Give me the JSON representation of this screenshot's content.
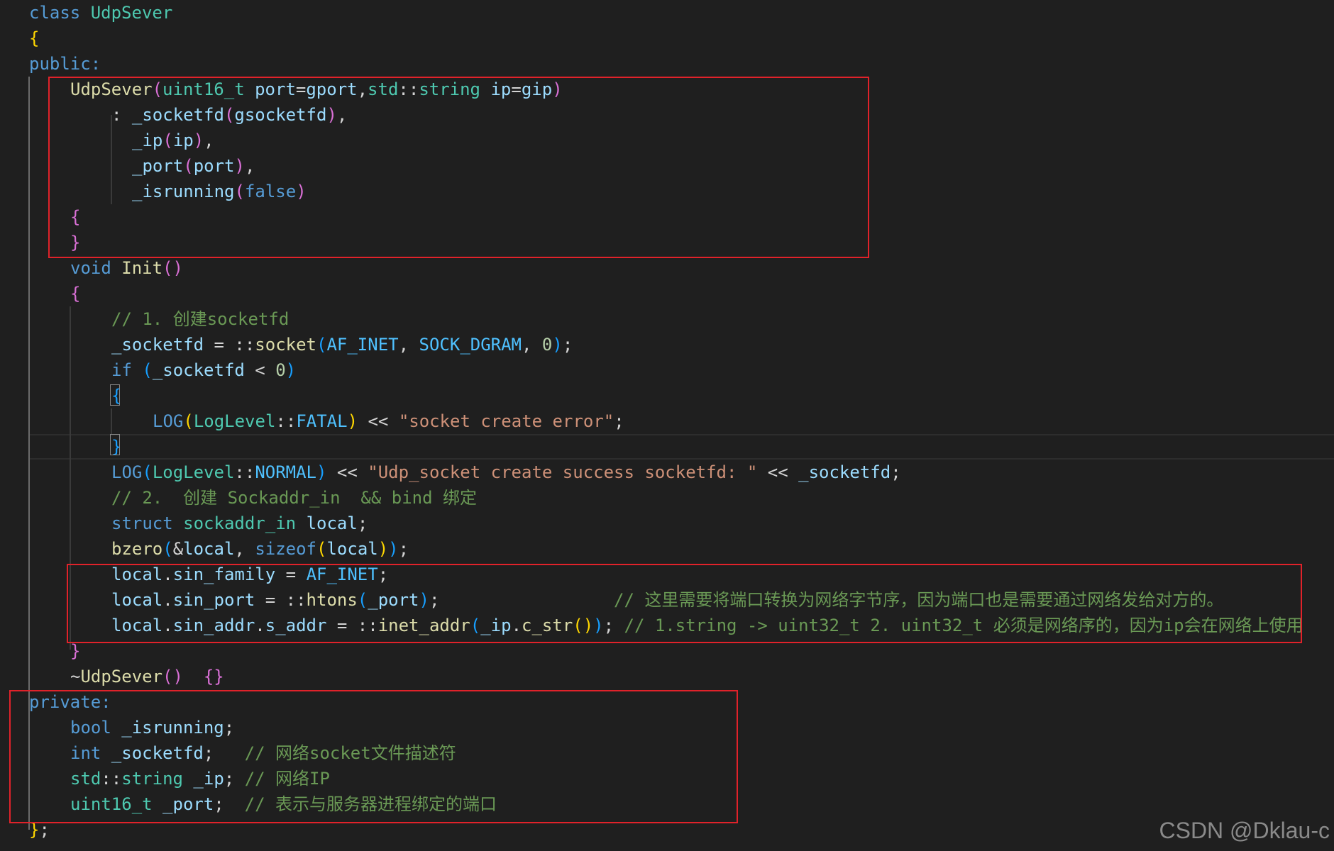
{
  "colors": {
    "background": "#1f1f1f",
    "keyword": "#569cd6",
    "type": "#4ec9b0",
    "function": "#dcdcaa",
    "variable": "#9cdcfe",
    "string": "#ce9178",
    "number": "#b5cea8",
    "comment": "#6a9955",
    "enum_constant": "#4fc1ff",
    "default": "#d4d4d4",
    "bracket_level_1": "#ffd700",
    "bracket_level_2": "#da70d6",
    "bracket_level_3": "#179fff",
    "highlight_box": "#e0222a"
  },
  "code_lines": [
    {
      "indent": 1,
      "tokens": [
        [
          "class ",
          "kw"
        ],
        [
          "UdpSever",
          "ty"
        ]
      ]
    },
    {
      "indent": 1,
      "tokens": [
        [
          "{",
          "b1"
        ]
      ]
    },
    {
      "indent": 1,
      "tokens": [
        [
          "public:",
          "kw"
        ]
      ]
    },
    {
      "indent": 3,
      "tokens": [
        [
          "UdpSever",
          "fn"
        ],
        [
          "(",
          "b2"
        ],
        [
          "uint16_t",
          "ty"
        ],
        [
          " ",
          "pun"
        ],
        [
          "port",
          "var"
        ],
        [
          "=",
          "pun"
        ],
        [
          "gport",
          "var"
        ],
        [
          ",",
          "pun"
        ],
        [
          "std",
          "ty"
        ],
        [
          "::",
          "pun"
        ],
        [
          "string",
          "ty"
        ],
        [
          " ",
          "pun"
        ],
        [
          "ip",
          "var"
        ],
        [
          "=",
          "pun"
        ],
        [
          "gip",
          "var"
        ],
        [
          ")",
          "b2"
        ]
      ]
    },
    {
      "indent": 5,
      "tokens": [
        [
          ": ",
          "pun"
        ],
        [
          "_socketfd",
          "var"
        ],
        [
          "(",
          "b2"
        ],
        [
          "gsocketfd",
          "var"
        ],
        [
          ")",
          "b2"
        ],
        [
          ",",
          "pun"
        ]
      ]
    },
    {
      "indent": 6,
      "tokens": [
        [
          "_ip",
          "var"
        ],
        [
          "(",
          "b2"
        ],
        [
          "ip",
          "var"
        ],
        [
          ")",
          "b2"
        ],
        [
          ",",
          "pun"
        ]
      ]
    },
    {
      "indent": 6,
      "tokens": [
        [
          "_port",
          "var"
        ],
        [
          "(",
          "b2"
        ],
        [
          "port",
          "var"
        ],
        [
          ")",
          "b2"
        ],
        [
          ",",
          "pun"
        ]
      ]
    },
    {
      "indent": 6,
      "tokens": [
        [
          "_isrunning",
          "var"
        ],
        [
          "(",
          "b2"
        ],
        [
          "false",
          "kw"
        ],
        [
          ")",
          "b2"
        ]
      ]
    },
    {
      "indent": 3,
      "tokens": [
        [
          "{",
          "b2"
        ]
      ]
    },
    {
      "indent": 3,
      "tokens": [
        [
          "}",
          "b2"
        ]
      ]
    },
    {
      "indent": 3,
      "tokens": [
        [
          "void ",
          "kw"
        ],
        [
          "Init",
          "fn"
        ],
        [
          "()",
          "b2"
        ]
      ]
    },
    {
      "indent": 3,
      "tokens": [
        [
          "{",
          "b2"
        ]
      ]
    },
    {
      "indent": 5,
      "tokens": [
        [
          "// 1. 创建socketfd",
          "cm"
        ]
      ]
    },
    {
      "indent": 5,
      "tokens": [
        [
          "_socketfd",
          "var"
        ],
        [
          " = ::",
          "pun"
        ],
        [
          "socket",
          "fn"
        ],
        [
          "(",
          "b3"
        ],
        [
          "AF_INET",
          "en"
        ],
        [
          ", ",
          "pun"
        ],
        [
          "SOCK_DGRAM",
          "en"
        ],
        [
          ", ",
          "pun"
        ],
        [
          "0",
          "num"
        ],
        [
          ")",
          "b3"
        ],
        [
          ";",
          "pun"
        ]
      ]
    },
    {
      "indent": 5,
      "tokens": [
        [
          "if ",
          "kw"
        ],
        [
          "(",
          "b3"
        ],
        [
          "_socketfd",
          "var"
        ],
        [
          " < ",
          "pun"
        ],
        [
          "0",
          "num"
        ],
        [
          ")",
          "b3"
        ]
      ]
    },
    {
      "indent": 5,
      "tokens": [
        [
          "{",
          "b3"
        ]
      ]
    },
    {
      "indent": 7,
      "tokens": [
        [
          "LOG",
          "kw"
        ],
        [
          "(",
          "b1"
        ],
        [
          "LogLevel",
          "ty"
        ],
        [
          "::",
          "pun"
        ],
        [
          "FATAL",
          "en"
        ],
        [
          ")",
          "b1"
        ],
        [
          " << ",
          "pun"
        ],
        [
          "\"socket create error\"",
          "str"
        ],
        [
          ";",
          "pun"
        ]
      ]
    },
    {
      "indent": 5,
      "tokens": [
        [
          "}",
          "b3"
        ]
      ]
    },
    {
      "indent": 5,
      "tokens": [
        [
          "LOG",
          "kw"
        ],
        [
          "(",
          "b3"
        ],
        [
          "LogLevel",
          "ty"
        ],
        [
          "::",
          "pun"
        ],
        [
          "NORMAL",
          "en"
        ],
        [
          ")",
          "b3"
        ],
        [
          " << ",
          "pun"
        ],
        [
          "\"Udp_socket create success socketfd: \"",
          "str"
        ],
        [
          " << ",
          "pun"
        ],
        [
          "_socketfd",
          "var"
        ],
        [
          ";",
          "pun"
        ]
      ]
    },
    {
      "indent": 5,
      "tokens": [
        [
          "// 2.  创建 Sockaddr_in  && bind 绑定",
          "cm"
        ]
      ]
    },
    {
      "indent": 5,
      "tokens": [
        [
          "struct ",
          "kw"
        ],
        [
          "sockaddr_in",
          "ty"
        ],
        [
          " ",
          "pun"
        ],
        [
          "local",
          "var"
        ],
        [
          ";",
          "pun"
        ]
      ]
    },
    {
      "indent": 5,
      "tokens": [
        [
          "bzero",
          "fn"
        ],
        [
          "(",
          "b3"
        ],
        [
          "&",
          "pun"
        ],
        [
          "local",
          "var"
        ],
        [
          ", ",
          "pun"
        ],
        [
          "sizeof",
          "kw"
        ],
        [
          "(",
          "b1"
        ],
        [
          "local",
          "var"
        ],
        [
          ")",
          "b1"
        ],
        [
          ")",
          "b3"
        ],
        [
          ";",
          "pun"
        ]
      ]
    },
    {
      "indent": 5,
      "tokens": [
        [
          "local",
          "var"
        ],
        [
          ".",
          "pun"
        ],
        [
          "sin_family",
          "var"
        ],
        [
          " = ",
          "pun"
        ],
        [
          "AF_INET",
          "en"
        ],
        [
          ";",
          "pun"
        ]
      ]
    },
    {
      "indent": 5,
      "tokens": [
        [
          "local",
          "var"
        ],
        [
          ".",
          "pun"
        ],
        [
          "sin_port",
          "var"
        ],
        [
          " = ::",
          "pun"
        ],
        [
          "htons",
          "fn"
        ],
        [
          "(",
          "b3"
        ],
        [
          "_port",
          "var"
        ],
        [
          ")",
          "b3"
        ],
        [
          ";",
          "pun"
        ],
        [
          "                 ",
          "pun"
        ],
        [
          "// 这里需要将端口转换为网络字节序，因为端口也是需要通过网络发给对方的。",
          "cm"
        ]
      ]
    },
    {
      "indent": 5,
      "tokens": [
        [
          "local",
          "var"
        ],
        [
          ".",
          "pun"
        ],
        [
          "sin_addr",
          "var"
        ],
        [
          ".",
          "pun"
        ],
        [
          "s_addr",
          "var"
        ],
        [
          " = ::",
          "pun"
        ],
        [
          "inet_addr",
          "fn"
        ],
        [
          "(",
          "b3"
        ],
        [
          "_ip",
          "var"
        ],
        [
          ".",
          "pun"
        ],
        [
          "c_str",
          "fn"
        ],
        [
          "()",
          "b1"
        ],
        [
          ")",
          "b3"
        ],
        [
          ";",
          "pun"
        ],
        [
          " ",
          "pun"
        ],
        [
          "// 1.string -> uint32_t 2. uint32_t 必须是网络序的，因为ip会在网络上使用",
          "cm"
        ]
      ]
    },
    {
      "indent": 3,
      "tokens": [
        [
          "}",
          "b2"
        ]
      ]
    },
    {
      "indent": 3,
      "tokens": [
        [
          "~",
          "pun"
        ],
        [
          "UdpSever",
          "fn"
        ],
        [
          "()",
          "b2"
        ],
        [
          "  ",
          "pun"
        ],
        [
          "{}",
          "b2"
        ]
      ]
    },
    {
      "indent": 1,
      "tokens": [
        [
          "private:",
          "kw"
        ]
      ]
    },
    {
      "indent": 3,
      "tokens": [
        [
          "bool ",
          "kw"
        ],
        [
          "_isrunning",
          "var"
        ],
        [
          ";",
          "pun"
        ]
      ]
    },
    {
      "indent": 3,
      "tokens": [
        [
          "int ",
          "kw"
        ],
        [
          "_socketfd",
          "var"
        ],
        [
          ";",
          "pun"
        ],
        [
          "   ",
          "pun"
        ],
        [
          "// 网络socket文件描述符",
          "cm"
        ]
      ]
    },
    {
      "indent": 3,
      "tokens": [
        [
          "std",
          "ty"
        ],
        [
          "::",
          "pun"
        ],
        [
          "string",
          "ty"
        ],
        [
          " ",
          "pun"
        ],
        [
          "_ip",
          "var"
        ],
        [
          ";",
          "pun"
        ],
        [
          " ",
          "pun"
        ],
        [
          "// 网络IP",
          "cm"
        ]
      ]
    },
    {
      "indent": 3,
      "tokens": [
        [
          "uint16_t",
          "ty"
        ],
        [
          " ",
          "pun"
        ],
        [
          "_port",
          "var"
        ],
        [
          ";",
          "pun"
        ],
        [
          "  ",
          "pun"
        ],
        [
          "// 表示与服务器进程绑定的端口",
          "cm"
        ]
      ]
    },
    {
      "indent": 1,
      "tokens": [
        [
          "}",
          "b1"
        ],
        [
          ";",
          "pun"
        ]
      ]
    }
  ],
  "watermark": "CSDN @Dklau-c"
}
